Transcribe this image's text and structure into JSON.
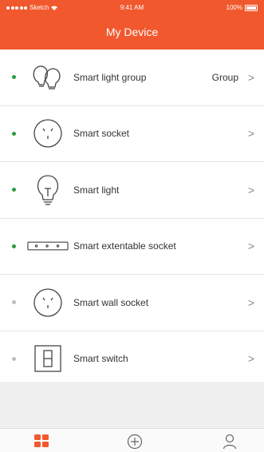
{
  "status_bar": {
    "carrier": "Sketch",
    "time": "9:41 AM",
    "battery": "100%"
  },
  "header": {
    "title": "My Device"
  },
  "colors": {
    "accent": "#f1582d",
    "online": "#2f9a3c",
    "offline": "#bdbdbd",
    "chevron": "#888888"
  },
  "devices": [
    {
      "label": "Smart light group",
      "aux": "Group",
      "online": true,
      "icon": "light-group-icon"
    },
    {
      "label": "Smart socket",
      "aux": "",
      "online": true,
      "icon": "socket-icon"
    },
    {
      "label": "Smart light",
      "aux": "",
      "online": true,
      "icon": "bulb-icon"
    },
    {
      "label": "Smart extentable socket",
      "aux": "",
      "online": true,
      "icon": "power-strip-icon"
    },
    {
      "label": "Smart wall socket",
      "aux": "",
      "online": false,
      "icon": "wall-socket-icon"
    },
    {
      "label": "Smart switch",
      "aux": "",
      "online": false,
      "icon": "switch-icon"
    }
  ],
  "chevron": ">",
  "tabs": [
    {
      "name": "home",
      "icon": "grid-icon",
      "active": true
    },
    {
      "name": "add",
      "icon": "add-circle-icon",
      "active": false
    },
    {
      "name": "profile",
      "icon": "user-icon",
      "active": false
    }
  ]
}
